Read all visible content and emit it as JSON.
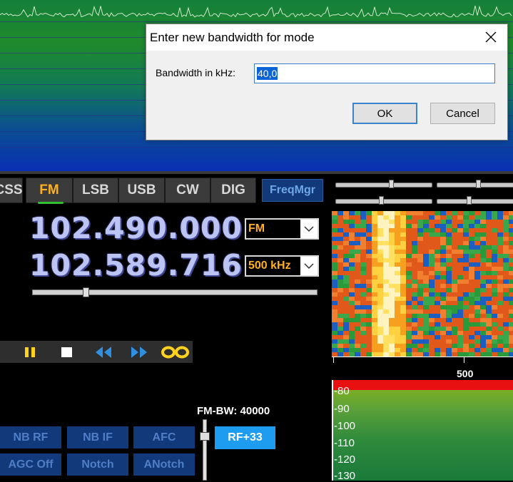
{
  "dialog": {
    "title": "Enter new bandwidth for mode",
    "close_glyph": "✕",
    "bandwidth_label": "Bandwidth in kHz:",
    "bandwidth_value": "40,0",
    "ok_label": "OK",
    "cancel_label": "Cancel"
  },
  "modes": {
    "tabs": [
      {
        "label": "CSS"
      },
      {
        "label": "FM",
        "active": true
      },
      {
        "label": "LSB"
      },
      {
        "label": "USB"
      },
      {
        "label": "CW"
      },
      {
        "label": "DIG"
      }
    ],
    "freqmgr_label": "FreqMgr"
  },
  "tuning": {
    "vfo_frequency": "102.490.000",
    "mode_select": "FM",
    "center_frequency": "102.589.716",
    "span_select": "500 kHz"
  },
  "player": {
    "icons": [
      "pause-icon",
      "stop-icon",
      "rewind-icon",
      "fast-forward-icon",
      "loop-icon"
    ]
  },
  "waterfall": {
    "axis_label": "500"
  },
  "level_meter": {
    "labels": [
      "-80",
      "-90",
      "-100",
      "-110",
      "-120",
      "-130"
    ]
  },
  "dsp": {
    "fm_bw_label": "FM-BW: 40000",
    "buttons": [
      {
        "label": "NB RF"
      },
      {
        "label": "NB IF"
      },
      {
        "label": "AFC"
      },
      {
        "label": "AGC Off"
      },
      {
        "label": "Notch"
      },
      {
        "label": "ANotch"
      }
    ],
    "rf_gain_label": "RF+33"
  },
  "colors": {
    "accent_orange": "#ffb020",
    "freq_text": "#bcc4f4",
    "dsp_button_bg": "#123a7a",
    "rf_button_bg": "#1e9cf0"
  }
}
